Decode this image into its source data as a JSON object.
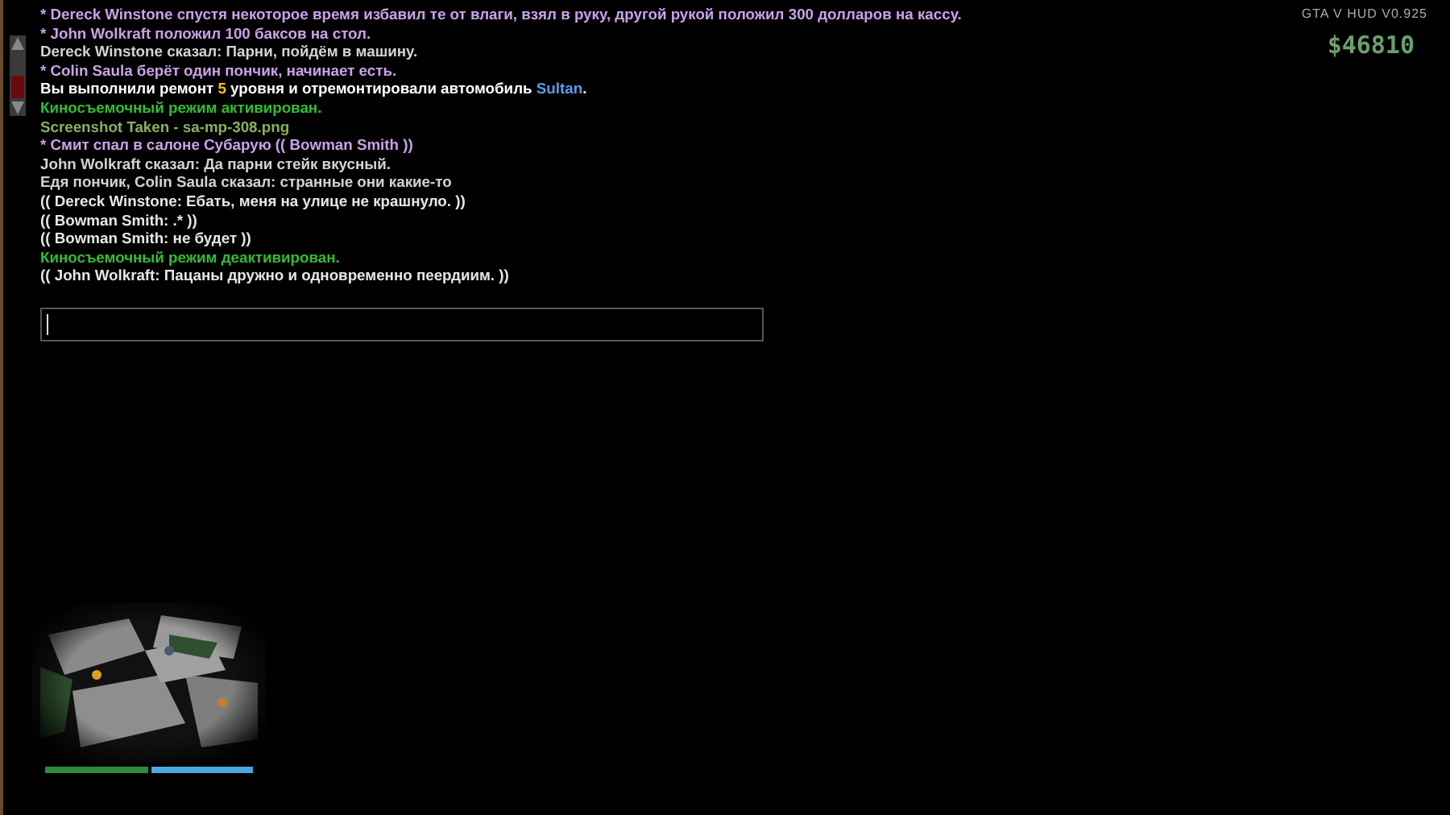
{
  "chat": {
    "lines": [
      {
        "segments": [
          {
            "text": "* Dereck Winstone спустя некоторое время избавил те от влаги, взял в руку, другой рукой положил 300 долларов на кассу.",
            "color": "#c8a2e8"
          }
        ]
      },
      {
        "segments": [
          {
            "text": "* John Wolkraft положил 100 баксов на стол.",
            "color": "#c8a2e8"
          }
        ]
      },
      {
        "segments": [
          {
            "text": "Dereck Winstone сказал: Парни, пойдём в машину.",
            "color": "#d2d2d2"
          }
        ]
      },
      {
        "segments": [
          {
            "text": "* Colin Saula берёт один пончик, начинает есть.",
            "color": "#c8a2e8"
          }
        ]
      },
      {
        "segments": [
          {
            "text": "Вы выполнили ремонт ",
            "color": "#ffffff"
          },
          {
            "text": "5",
            "color": "#f0c020"
          },
          {
            "text": " уровня и отремонтировали автомобиль ",
            "color": "#ffffff"
          },
          {
            "text": "Sultan",
            "color": "#5a9ae8"
          },
          {
            "text": ".",
            "color": "#ffffff"
          }
        ]
      },
      {
        "segments": [
          {
            "text": "Киносъемочный режим активирован.",
            "color": "#33bb33"
          }
        ]
      },
      {
        "segments": [
          {
            "text": "Screenshot Taken - sa-mp-308.png",
            "color": "#88b060"
          }
        ]
      },
      {
        "segments": [
          {
            "text": "* Смит спал в салоне Субарую (( Bowman Smith ))",
            "color": "#c8a2e8"
          }
        ]
      },
      {
        "segments": [
          {
            "text": "John Wolkraft сказал: Да парни стейк вкусный.",
            "color": "#d2d2d2"
          }
        ]
      },
      {
        "segments": [
          {
            "text": "Едя пончик, Colin Saula сказал: странные они какие-то",
            "color": "#d2d2d2"
          }
        ]
      },
      {
        "segments": [
          {
            "text": "(( Dereck Winstone: Ебать, меня на улице не крашнуло. ))",
            "color": "#e6e6e6"
          }
        ]
      },
      {
        "segments": [
          {
            "text": "(( Bowman Smith: .* ))",
            "color": "#e6e6e6"
          }
        ]
      },
      {
        "segments": [
          {
            "text": "(( Bowman Smith: не будет ))",
            "color": "#e6e6e6"
          }
        ]
      },
      {
        "segments": [
          {
            "text": "Киносъемочный режим деактивирован.",
            "color": "#33bb33"
          }
        ]
      },
      {
        "segments": [
          {
            "text": "(( John Wolkraft: Пацаны дружно и одновременно пеердиим. ))",
            "color": "#e6e6e6"
          }
        ]
      }
    ]
  },
  "hud": {
    "version": "GTA V HUD V0.925",
    "money": "$46810"
  },
  "minimap": {
    "health": {
      "level": 1
    },
    "armor": {
      "level": 1
    }
  }
}
